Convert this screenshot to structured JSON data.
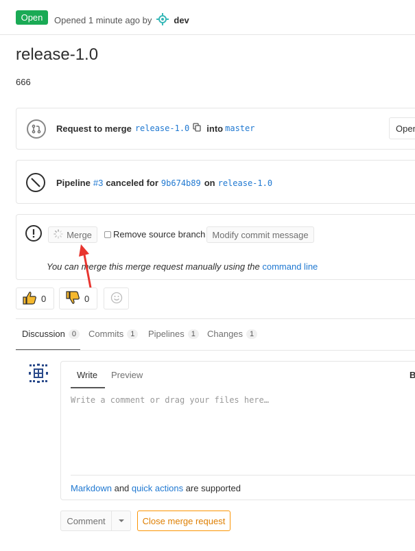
{
  "header": {
    "status_badge": "Open",
    "opened_text": "Opened 1 minute ago by",
    "author": "dev"
  },
  "mr": {
    "title": "release-1.0",
    "description": "666"
  },
  "merge_info": {
    "request_label": "Request to merge",
    "source_branch": "release-1.0",
    "into_label": "into",
    "target_branch": "master",
    "open_button": "Open"
  },
  "pipeline": {
    "label": "Pipeline",
    "id": "#3",
    "status_text": "canceled for",
    "commit": "9b674b89",
    "on_label": "on",
    "branch": "release-1.0"
  },
  "merge_actions": {
    "merge_button": "Merge",
    "remove_source_label": "Remove source branch",
    "modify_commit_button": "Modify commit message",
    "manual_merge_text": "You can merge this merge request manually using the",
    "command_line_link": "command line"
  },
  "awards": {
    "thumbs_up_count": "0",
    "thumbs_down_count": "0"
  },
  "tabs": [
    {
      "label": "Discussion",
      "count": "0"
    },
    {
      "label": "Commits",
      "count": "1"
    },
    {
      "label": "Pipelines",
      "count": "1"
    },
    {
      "label": "Changes",
      "count": "1"
    }
  ],
  "comment_form": {
    "write_tab": "Write",
    "preview_tab": "Preview",
    "toolbar_bold": "B",
    "placeholder": "Write a comment or drag your files here…",
    "markdown_link": "Markdown",
    "and_text": "and",
    "quick_actions_link": "quick actions",
    "supported_text": "are supported",
    "comment_button": "Comment",
    "close_button": "Close merge request"
  },
  "colors": {
    "open_badge": "#1aaa55",
    "link": "#1f78d1",
    "close_button": "#fc9403",
    "annotation_arrow": "#e8352f"
  }
}
